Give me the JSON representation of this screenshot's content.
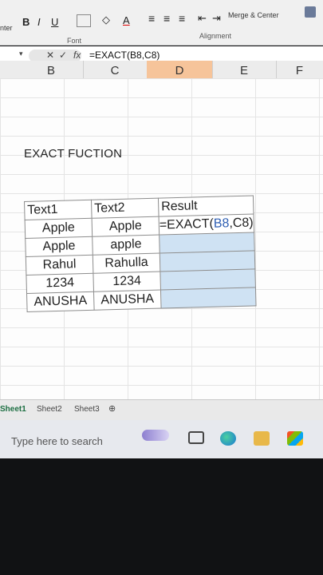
{
  "ribbon": {
    "left_cut": "nter",
    "bold": "B",
    "italic": "I",
    "underline": "U",
    "font_color": "A",
    "font_group": "Font",
    "merge_center": "Merge & Center",
    "alignment_group": "Alignment"
  },
  "formula_bar": {
    "formula": "=EXACT(B8,C8)",
    "fx": "fx"
  },
  "columns": [
    "B",
    "C",
    "D",
    "E",
    "F"
  ],
  "sheet": {
    "title": "EXACT FUCTION",
    "headers": [
      "Text1",
      "Text2",
      "Result"
    ],
    "rows": [
      {
        "t1": "Apple",
        "t2": "Apple"
      },
      {
        "t1": "Apple",
        "t2": "apple"
      },
      {
        "t1": "Rahul",
        "t2": "Rahulla"
      },
      {
        "t1": "1234",
        "t2": "1234"
      },
      {
        "t1": "ANUSHA",
        "t2": "ANUSHA"
      }
    ],
    "formula_cell": {
      "prefix": "=EXACT(",
      "ref1": "B8",
      "comma": ",",
      "ref2": "C8",
      "suffix": ")"
    }
  },
  "tabs": [
    "Sheet1",
    "Sheet2",
    "Sheet3"
  ],
  "taskbar": {
    "search_placeholder": "Type here to search"
  },
  "colors": {
    "active_col": "#f6c49a",
    "header_text": "#c0504d",
    "selection": "#cfe2f3"
  }
}
